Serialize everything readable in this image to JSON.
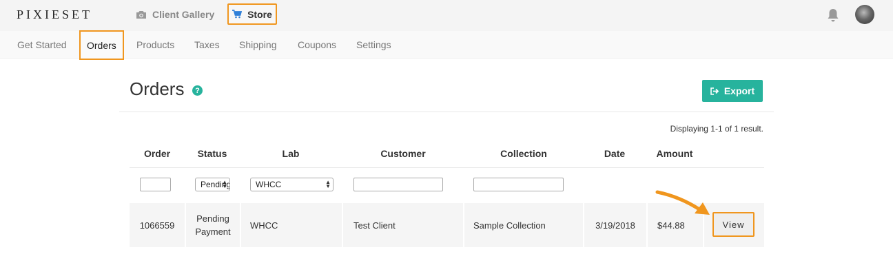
{
  "brand": {
    "logo_text": "PIXIESET"
  },
  "top_nav": {
    "gallery_label": "Client Gallery",
    "store_label": "Store",
    "gallery_icon": "camera-icon",
    "store_icon": "cart-icon",
    "store_icon_color": "#2f7fd8"
  },
  "sub_nav": {
    "items": [
      {
        "label": "Get Started"
      },
      {
        "label": "Orders",
        "active": true
      },
      {
        "label": "Products"
      },
      {
        "label": "Taxes"
      },
      {
        "label": "Shipping"
      },
      {
        "label": "Coupons"
      },
      {
        "label": "Settings"
      }
    ]
  },
  "page": {
    "title": "Orders",
    "help_icon_text": "?",
    "export_label": "Export",
    "display_count": "Displaying 1-1 of 1 result."
  },
  "table": {
    "columns": [
      "Order",
      "Status",
      "Lab",
      "Customer",
      "Collection",
      "Date",
      "Amount"
    ],
    "filters": {
      "status_selected": "Pending",
      "lab_selected": "WHCC"
    },
    "rows": [
      {
        "order": "1066559",
        "status": "Pending Payment",
        "lab": "WHCC",
        "customer": "Test Client",
        "collection": "Sample Collection",
        "date": "3/19/2018",
        "amount": "$44.88",
        "action_label": "View"
      }
    ]
  },
  "colors": {
    "accent": "#27b39d",
    "highlight": "#f0961e"
  }
}
